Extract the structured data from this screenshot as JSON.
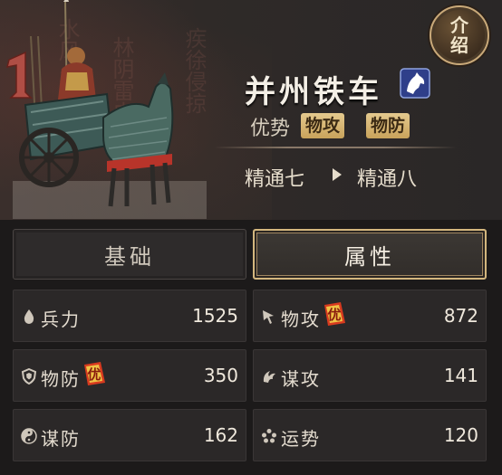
{
  "unit": {
    "name": "并州铁车",
    "type_icon": "horse-head-icon",
    "advantage_label": "优势",
    "advantage_tags": [
      "物攻",
      "物防"
    ],
    "mastery_from": "精通七",
    "mastery_to": "精通八"
  },
  "intro_button": {
    "label": "介绍"
  },
  "tabs": [
    {
      "label": "基础",
      "active": false
    },
    {
      "label": "属性",
      "active": true
    }
  ],
  "advantage_badge_text": "优",
  "stats": [
    {
      "label": "兵力",
      "value": "1525",
      "icon": "blood-drop-icon",
      "advantage": false
    },
    {
      "label": "物攻",
      "value": "872",
      "icon": "sword-cursor-icon",
      "advantage": true
    },
    {
      "label": "物防",
      "value": "350",
      "icon": "shield-icon",
      "advantage": true
    },
    {
      "label": "谋攻",
      "value": "141",
      "icon": "swirl-icon",
      "advantage": false
    },
    {
      "label": "谋防",
      "value": "162",
      "icon": "yin-yang-icon",
      "advantage": false
    },
    {
      "label": "运势",
      "value": "120",
      "icon": "dots-icon",
      "advantage": false
    }
  ],
  "colors": {
    "background": "#1c1a1a",
    "gold_accent": "#d3b67e",
    "badge_red": "#d83a1f",
    "badge_yellow": "#f2d34a"
  }
}
